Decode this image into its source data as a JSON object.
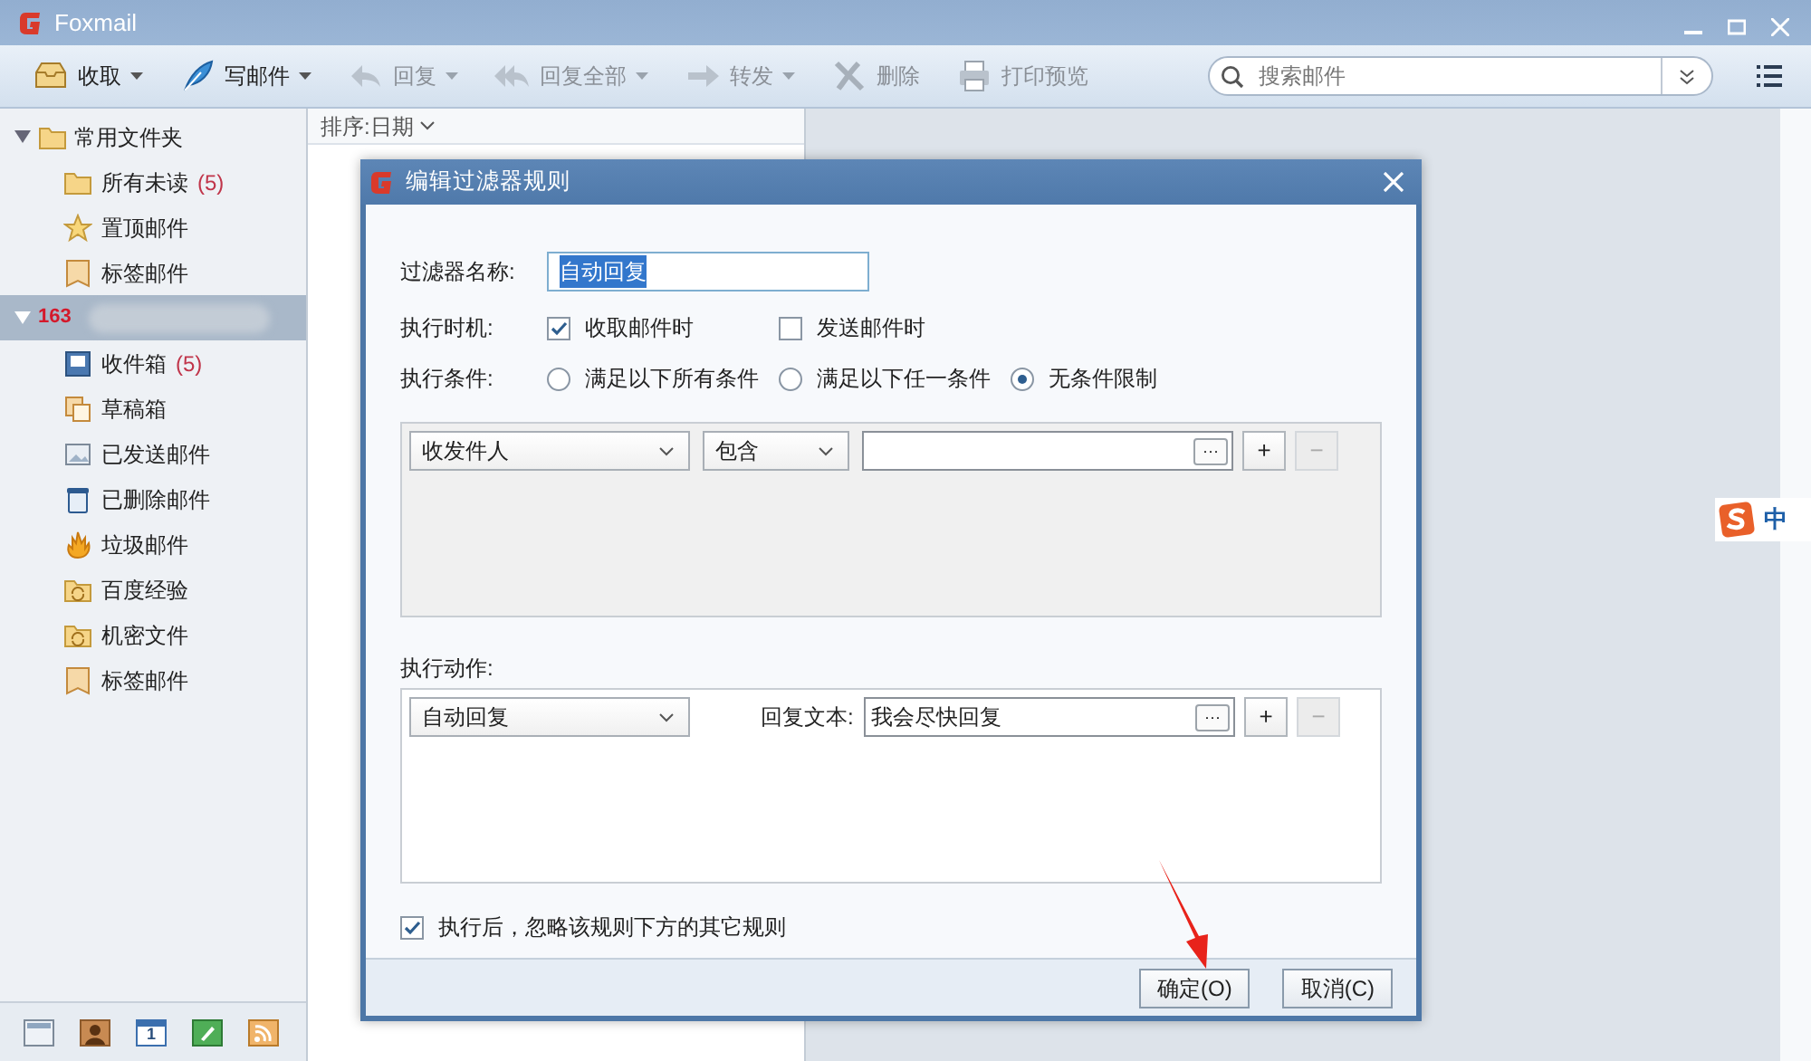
{
  "window": {
    "title": "Foxmail"
  },
  "toolbar": [
    {
      "label": "收取",
      "dropdown": true,
      "disabled": false
    },
    {
      "label": "写邮件",
      "dropdown": true,
      "disabled": false
    },
    {
      "label": "回复",
      "dropdown": true,
      "disabled": true
    },
    {
      "label": "回复全部",
      "dropdown": true,
      "disabled": true
    },
    {
      "label": "转发",
      "dropdown": true,
      "disabled": true
    },
    {
      "label": "删除",
      "dropdown": false,
      "disabled": true
    },
    {
      "label": "打印预览",
      "dropdown": false,
      "disabled": true
    }
  ],
  "search": {
    "placeholder": "搜索邮件"
  },
  "sidebar": {
    "groups": [
      {
        "label": "常用文件夹",
        "expanded": true,
        "selected": false,
        "items": [
          {
            "label": "所有未读",
            "count": "(5)"
          },
          {
            "label": "置顶邮件"
          },
          {
            "label": "标签邮件"
          }
        ]
      },
      {
        "label": "163",
        "expanded": true,
        "selected": true,
        "items": [
          {
            "label": "收件箱",
            "count": "(5)"
          },
          {
            "label": "草稿箱"
          },
          {
            "label": "已发送邮件"
          },
          {
            "label": "已删除邮件"
          },
          {
            "label": "垃圾邮件"
          },
          {
            "label": "百度经验"
          },
          {
            "label": "机密文件"
          },
          {
            "label": "标签邮件"
          }
        ]
      }
    ]
  },
  "bottom_bar": {
    "calendar_day": "1"
  },
  "list": {
    "sort_label": "排序:日期"
  },
  "ime": {
    "label": "中"
  },
  "dialog": {
    "title": "编辑过滤器规则",
    "name_label": "过滤器名称:",
    "name_value": "自动回复",
    "name_selected": true,
    "timing_label": "执行时机:",
    "timing_options": [
      {
        "label": "收取邮件时",
        "checked": true
      },
      {
        "label": "发送邮件时",
        "checked": false
      }
    ],
    "condition_label": "执行条件:",
    "condition_options": [
      {
        "label": "满足以下所有条件",
        "selected": false
      },
      {
        "label": "满足以下任一条件",
        "selected": false
      },
      {
        "label": "无条件限制",
        "selected": true
      }
    ],
    "condition_row": {
      "field": "收发件人",
      "operator": "包含",
      "browse": "···",
      "add": "+",
      "remove": "−",
      "remove_disabled": true
    },
    "action_label": "执行动作:",
    "action_row": {
      "action": "自动回复",
      "text_label": "回复文本:",
      "text_value": "我会尽快回复",
      "browse": "···",
      "add": "+",
      "remove": "−",
      "remove_disabled": true
    },
    "ignore_rest": {
      "label": "执行后，忽略该规则下方的其它规则",
      "checked": true
    },
    "buttons": [
      "确定(O)",
      "取消(C)"
    ]
  }
}
